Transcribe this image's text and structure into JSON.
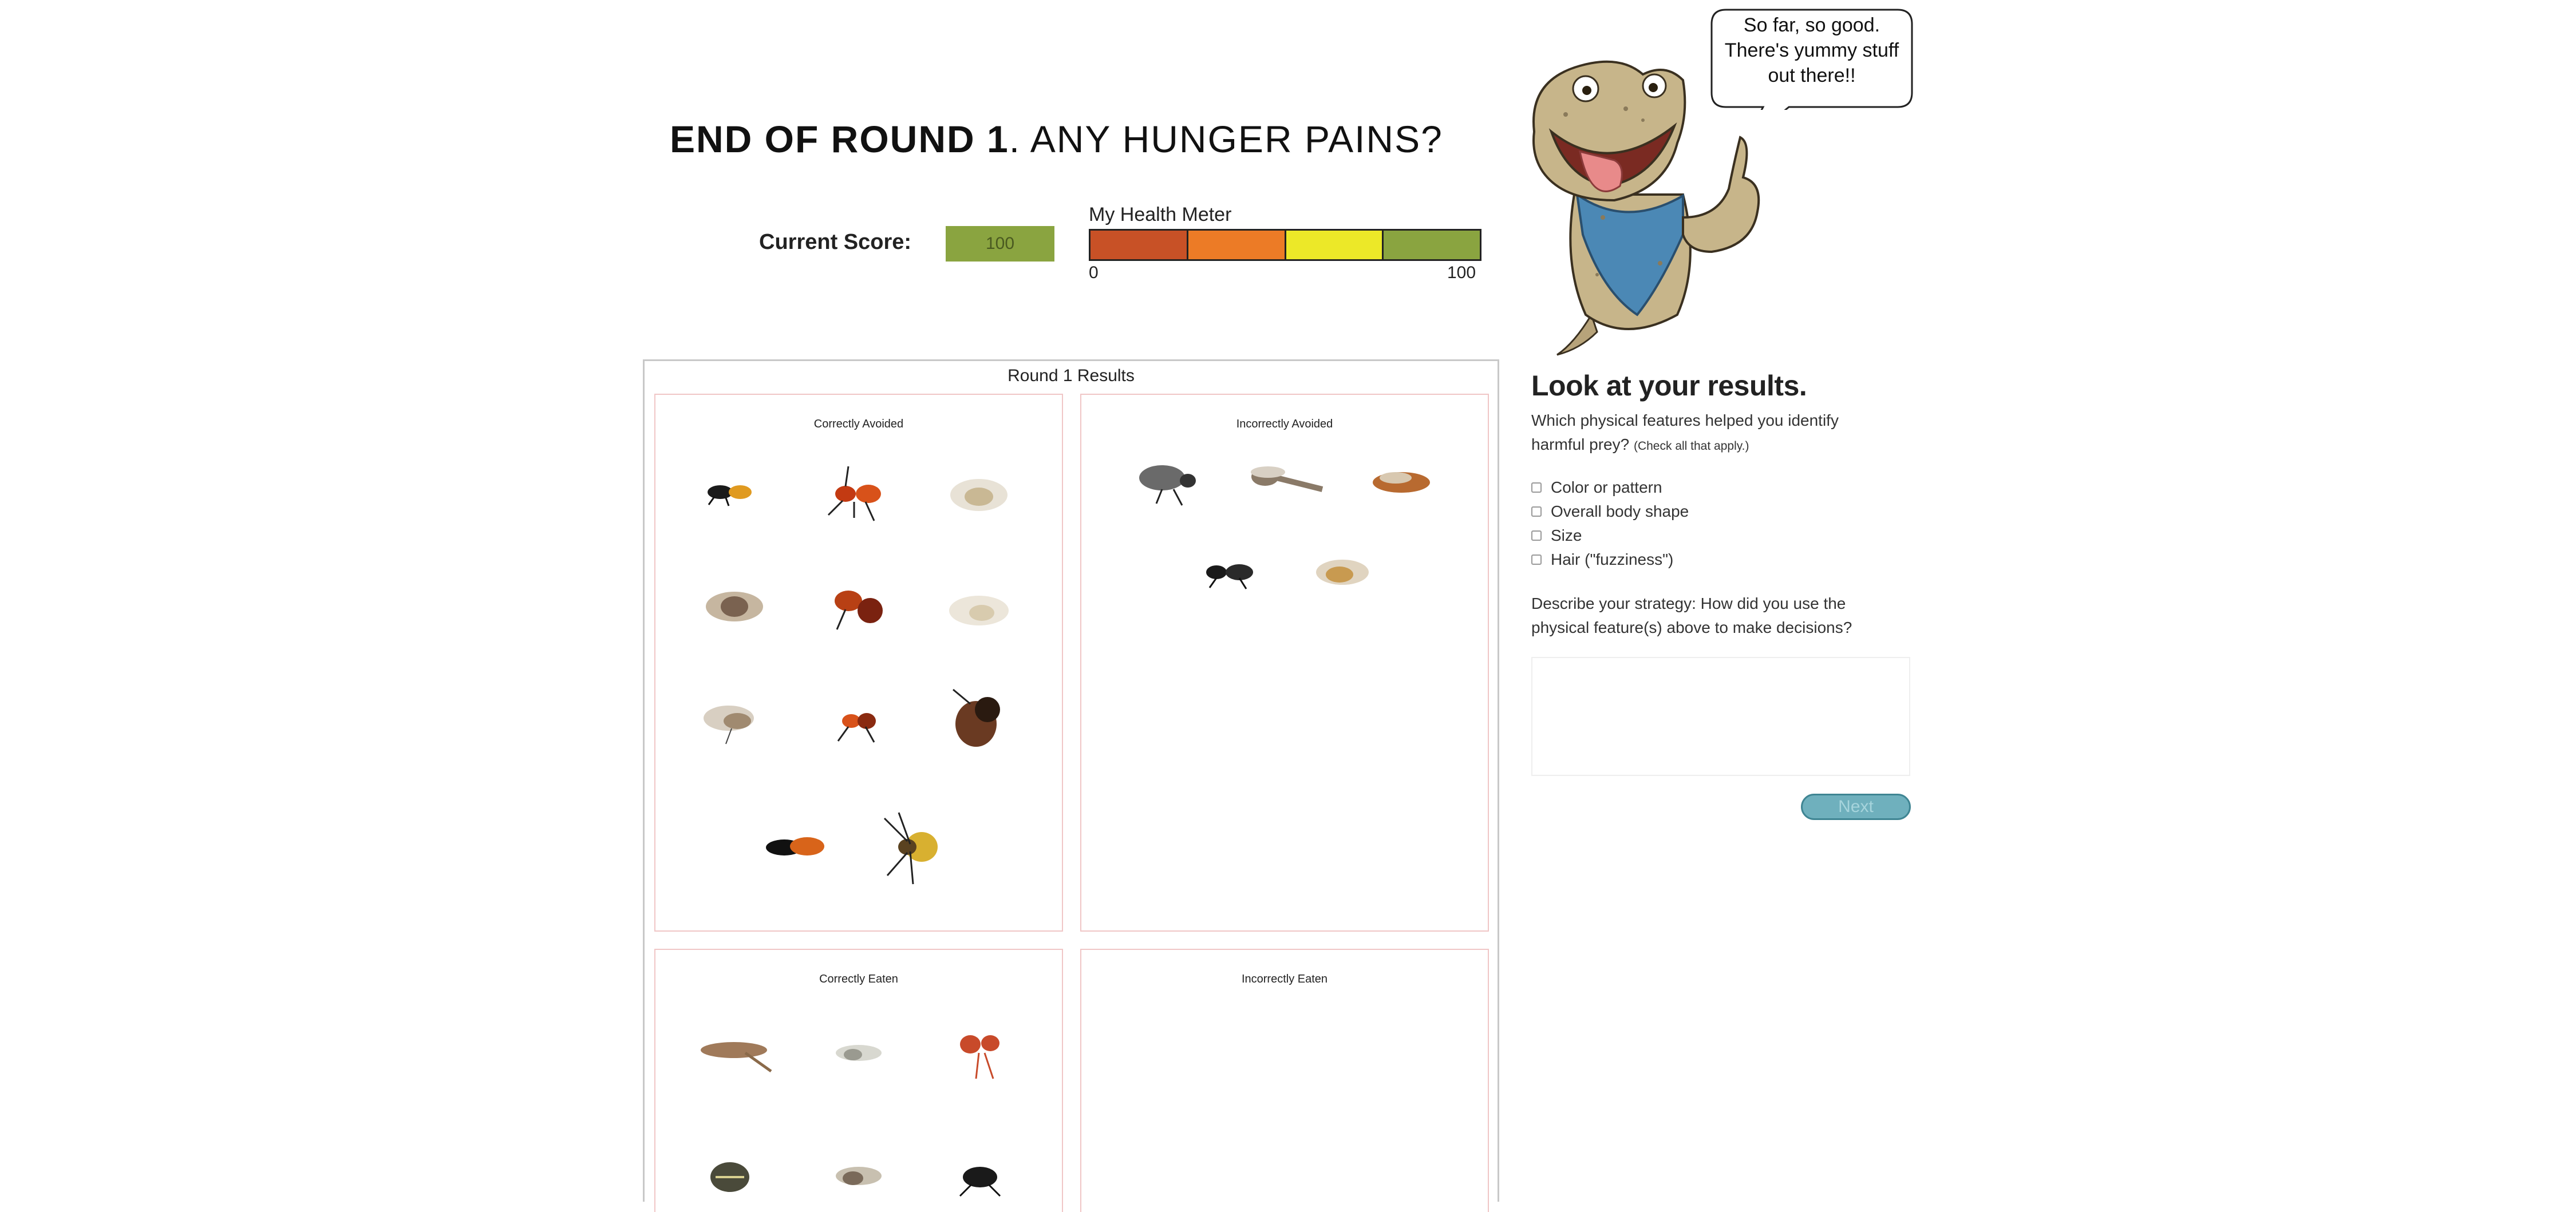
{
  "header": {
    "title_strong": "END OF ROUND 1",
    "title_rest": ". ANY HUNGER PAINS?"
  },
  "score": {
    "label": "Current Score:",
    "value": "100"
  },
  "health_meter": {
    "label": "My Health Meter",
    "min": "0",
    "max": "100",
    "colors": [
      "#c85126",
      "#ec7b26",
      "#ece828",
      "#8aa440"
    ]
  },
  "mascot": {
    "speech": [
      "So far, so good.",
      "There's yummy stuff",
      "out there!!"
    ]
  },
  "results": {
    "title": "Round 1 Results",
    "panels": {
      "correctly_avoided": "Correctly Avoided",
      "incorrectly_avoided": "Incorrectly Avoided",
      "correctly_eaten": "Correctly Eaten",
      "incorrectly_eaten": "Incorrectly Eaten"
    }
  },
  "survey": {
    "heading": "Look at your results.",
    "question": "Which physical features helped you identify harmful prey?",
    "question_hint": "(Check all that apply.)",
    "options": [
      "Color or pattern",
      "Overall body shape",
      "Size",
      "Hair (\"fuzziness\")"
    ],
    "strategy_prompt": "Describe your strategy: How did you use the physical feature(s) above to make decisions?",
    "strategy_value": "",
    "next_label": "Next"
  }
}
